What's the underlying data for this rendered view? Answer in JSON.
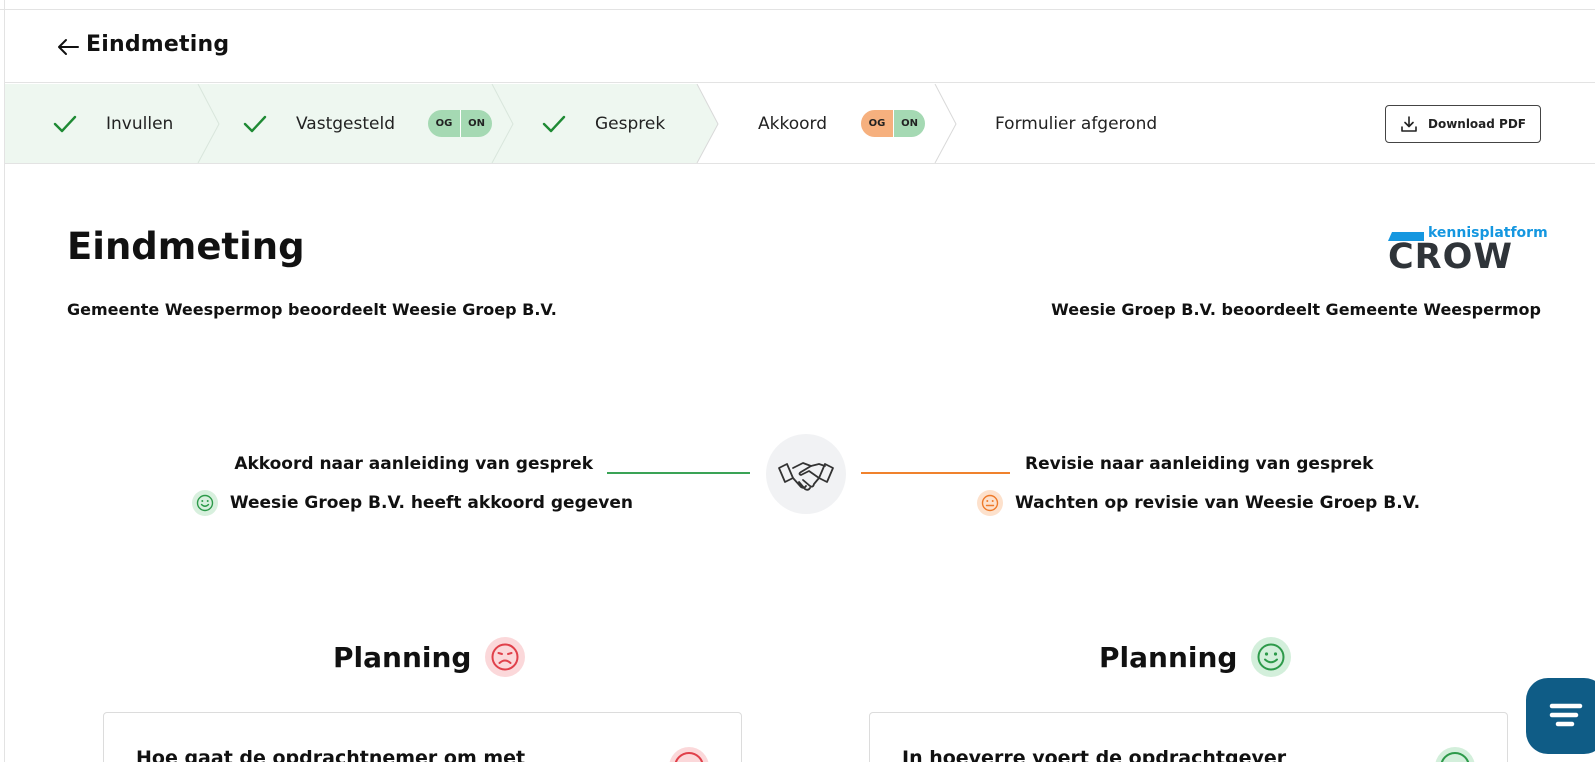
{
  "header": {
    "title": "Eindmeting"
  },
  "steps": [
    {
      "label": "Invullen",
      "done": true
    },
    {
      "label": "Vastgesteld",
      "done": true,
      "badges": [
        "OG",
        "ON"
      ]
    },
    {
      "label": "Gesprek",
      "done": true
    },
    {
      "label": "Akkoord",
      "done": false,
      "badges": [
        "OG",
        "ON"
      ]
    },
    {
      "label": "Formulier afgerond",
      "done": false
    }
  ],
  "download": {
    "label": "Download PDF"
  },
  "doc": {
    "title": "Eindmeting",
    "left_subtitle": "Gemeente Weespermop beoordeelt Weesie Groep B.V.",
    "right_subtitle": "Weesie Groep B.V. beoordeelt Gemeente Weespermop"
  },
  "logo": {
    "top": "kennisplatform",
    "main": "CROW"
  },
  "status": {
    "left_heading": "Akkoord naar aanleiding van gesprek",
    "left_detail": "Weesie Groep B.V. heeft akkoord gegeven",
    "right_heading": "Revisie naar aanleiding van gesprek",
    "right_detail": "Wachten op revisie van Weesie Groep B.V."
  },
  "sections": [
    {
      "title": "Planning",
      "mood": "sad",
      "question": "Hoe gaat de opdrachtnemer om met"
    },
    {
      "title": "Planning",
      "mood": "happy",
      "question": "In hoeverre voert de opdrachtgever"
    }
  ],
  "colors": {
    "done_bg": "#eef7f0",
    "check": "#1e8a34",
    "green": "#3aa356",
    "orange": "#f0822d",
    "red": "#e0404a",
    "chat": "#0f5c86"
  }
}
